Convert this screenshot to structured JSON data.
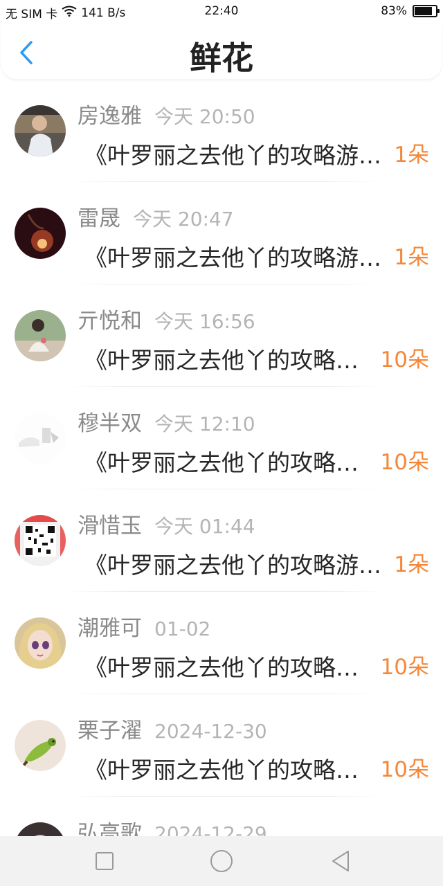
{
  "status": {
    "carrier": "无 SIM 卡",
    "speed": "141 B/s",
    "time": "22:40",
    "battery": "83%",
    "battery_level": 0.83
  },
  "header": {
    "title": "鲜花"
  },
  "records": [
    {
      "name": "房逸雅",
      "time": "今天 20:50",
      "work": "《叶罗丽之去他丫的攻略游戏》",
      "count": "1朵"
    },
    {
      "name": "雷晟",
      "time": "今天 20:47",
      "work": "《叶罗丽之去他丫的攻略游戏》",
      "count": "1朵"
    },
    {
      "name": "亓悦和",
      "time": "今天 16:56",
      "work": "《叶罗丽之去他丫的攻略游戏》",
      "count": "10朵"
    },
    {
      "name": "穆半双",
      "time": "今天 12:10",
      "work": "《叶罗丽之去他丫的攻略游戏》",
      "count": "10朵"
    },
    {
      "name": "滑惜玉",
      "time": "今天 01:44",
      "work": "《叶罗丽之去他丫的攻略游戏》",
      "count": "1朵"
    },
    {
      "name": "潮雅可",
      "time": "01-02",
      "work": "《叶罗丽之去他丫的攻略游戏》",
      "count": "10朵"
    },
    {
      "name": "栗子濯",
      "time": "2024-12-30",
      "work": "《叶罗丽之去他丫的攻略游戏》",
      "count": "10朵"
    },
    {
      "name": "弘高歌",
      "time": "2024-12-29",
      "work": "",
      "count": ""
    }
  ],
  "colors": {
    "accent_blue": "#2f9bf0",
    "count_orange": "#f5873a"
  }
}
